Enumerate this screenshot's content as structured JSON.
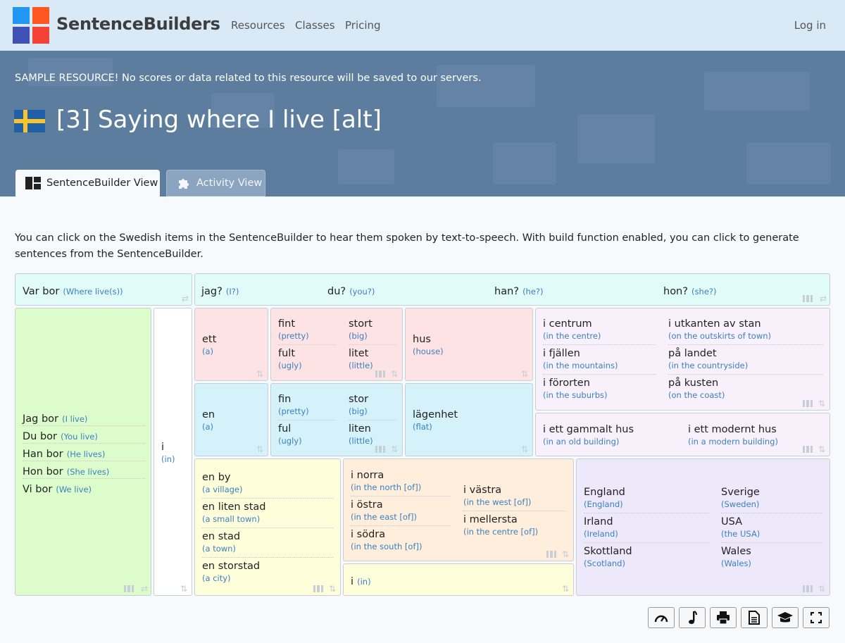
{
  "nav": {
    "brand": "SentenceBuilders",
    "links": [
      "Resources",
      "Classes",
      "Pricing"
    ],
    "login": "Log in",
    "logo_colors": [
      "#2196f3",
      "#ff5722",
      "#3f51b5",
      "#f44336"
    ]
  },
  "hero": {
    "notice": "SAMPLE RESOURCE! No scores or data related to this resource will be saved to our servers.",
    "title": "[3] Saying where I live [alt]",
    "flag": "sweden-flag",
    "tabs": [
      {
        "label": "SentenceBuilder View",
        "icon": "grid-layout-icon",
        "active": true
      },
      {
        "label": "Activity View",
        "icon": "puzzle-icon",
        "active": false
      }
    ]
  },
  "intro": "You can click on the Swedish items in the SentenceBuilder to hear them spoken by text-to-speech. With build function enabled, you can click to generate sentences from the SentenceBuilder.",
  "builder": {
    "question": {
      "w": "Var bor",
      "t": "(Where live(s))"
    },
    "pronouns": [
      {
        "w": "jag?",
        "t": "(I?)"
      },
      {
        "w": "du?",
        "t": "(you?)"
      },
      {
        "w": "han?",
        "t": "(he?)"
      },
      {
        "w": "hon?",
        "t": "(she?)"
      }
    ],
    "subjects": [
      {
        "w": "Jag bor",
        "t": "(I live)"
      },
      {
        "w": "Du bor",
        "t": "(You live)"
      },
      {
        "w": "Han bor",
        "t": "(He lives)"
      },
      {
        "w": "Hon bor",
        "t": "(She lives)"
      },
      {
        "w": "Vi bor",
        "t": "(We live)"
      }
    ],
    "prep_in": {
      "w": "i",
      "t": "(in)"
    },
    "article_ett": {
      "w": "ett",
      "t": "(a)"
    },
    "article_en": {
      "w": "en",
      "t": "(a)"
    },
    "adj_neuter": [
      {
        "w": "fint",
        "t": "(pretty)"
      },
      {
        "w": "stort",
        "t": "(big)"
      },
      {
        "w": "fult",
        "t": "(ugly)"
      },
      {
        "w": "litet",
        "t": "(little)"
      }
    ],
    "adj_common": [
      {
        "w": "fin",
        "t": "(pretty)"
      },
      {
        "w": "stor",
        "t": "(big)"
      },
      {
        "w": "ful",
        "t": "(ugly)"
      },
      {
        "w": "liten",
        "t": "(little)"
      }
    ],
    "noun_hus": {
      "w": "hus",
      "t": "(house)"
    },
    "noun_lagenhet": {
      "w": "lägenhet",
      "t": "(flat)"
    },
    "locations": [
      {
        "w": "i centrum",
        "t": "(in the centre)"
      },
      {
        "w": "i utkanten av stan",
        "t": "(on the outskirts of town)"
      },
      {
        "w": "i fjällen",
        "t": "(in the mountains)"
      },
      {
        "w": "på landet",
        "t": "(in the countryside)"
      },
      {
        "w": "i förorten",
        "t": "(in the suburbs)"
      },
      {
        "w": "på kusten",
        "t": "(on the coast)"
      }
    ],
    "buildings": [
      {
        "w": "i ett gammalt hus",
        "t": "(in an old building)"
      },
      {
        "w": "i ett modernt hus",
        "t": "(in a modern building)"
      }
    ],
    "places": [
      {
        "w": "en by",
        "t": "(a village)"
      },
      {
        "w": "en liten stad",
        "t": "(a small town)"
      },
      {
        "w": "en stad",
        "t": "(a town)"
      },
      {
        "w": "en storstad",
        "t": "(a city)"
      }
    ],
    "regions": [
      {
        "w": "i norra",
        "t": "(in the north [of])"
      },
      {
        "w": "i västra",
        "t": "(in the west [of])"
      },
      {
        "w": "i östra",
        "t": "(in the east [of])"
      },
      {
        "w": "i mellersta",
        "t": "(in the centre [of])"
      },
      {
        "w": "i södra",
        "t": "(in the south [of])"
      }
    ],
    "prep_in2": {
      "w": "i",
      "t": "(in)"
    },
    "countries": [
      {
        "w": "England",
        "t": "(England)"
      },
      {
        "w": "Sverige",
        "t": "(Sweden)"
      },
      {
        "w": "Irland",
        "t": "(Ireland)"
      },
      {
        "w": "USA",
        "t": "(the USA)"
      },
      {
        "w": "Skottland",
        "t": "(Scotland)"
      },
      {
        "w": "Wales",
        "t": "(Wales)"
      }
    ]
  },
  "toolbar": [
    {
      "name": "speedometer-icon"
    },
    {
      "name": "music-note-icon"
    },
    {
      "name": "printer-icon"
    },
    {
      "name": "document-icon"
    },
    {
      "name": "graduation-cap-icon"
    },
    {
      "name": "fullscreen-icon"
    }
  ]
}
